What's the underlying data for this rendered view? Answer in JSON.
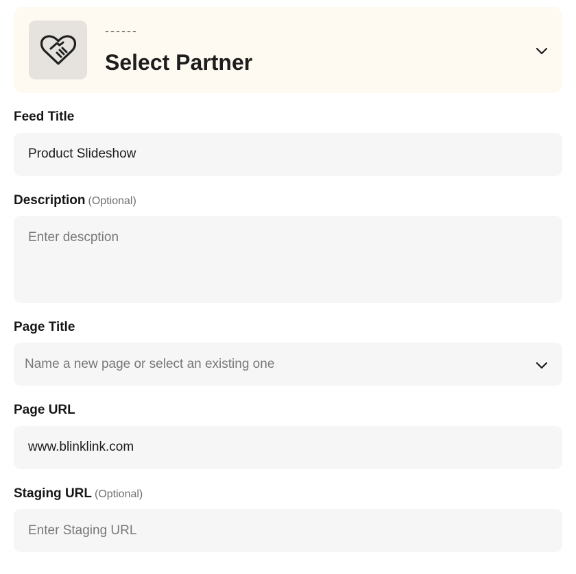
{
  "partner": {
    "dashes": "------",
    "title": "Select Partner",
    "avatar_icon": "handshake-heart-icon",
    "chevron_icon": "chevron-down-icon"
  },
  "fields": {
    "feed_title": {
      "label": "Feed Title",
      "value": "Product Slideshow"
    },
    "description": {
      "label": "Description",
      "optional": "(Optional)",
      "placeholder": "Enter descption"
    },
    "page_title": {
      "label": "Page Title",
      "placeholder": "Name a new page or select an existing one",
      "chevron_icon": "chevron-down-icon"
    },
    "page_url": {
      "label": "Page URL",
      "value": "www.blinklink.com"
    },
    "staging_url": {
      "label": "Staging URL",
      "optional": "(Optional)",
      "placeholder": "Enter Staging URL"
    }
  },
  "colors": {
    "card_background": "#fef9f1",
    "avatar_background": "#e6e3de",
    "input_background": "#f6f6f6",
    "placeholder_text": "#777777"
  }
}
